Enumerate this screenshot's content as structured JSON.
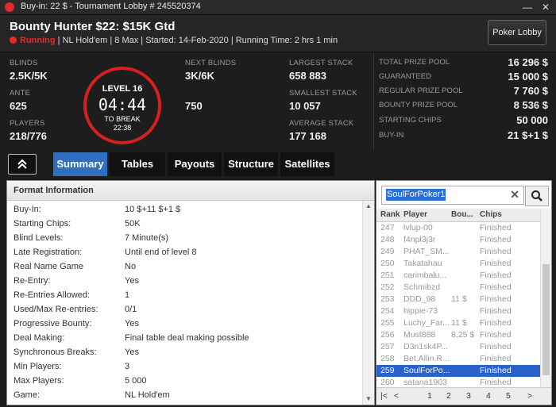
{
  "window": {
    "title": "Buy-in: 22 $ - Tournament Lobby # 245520374",
    "minimize": "—",
    "close": "✕"
  },
  "header": {
    "tournament_name": "Bounty Hunter $22: $15K Gtd",
    "status": "Running",
    "info": "| NL Hold'em | 8 Max | Started: 14-Feb-2020 | Running Time: 2 hrs  1 min",
    "lobby_button": "Poker Lobby"
  },
  "stats": {
    "blinds_label": "BLINDS",
    "blinds": "2.5K/5K",
    "ante_label": "ANTE",
    "ante": "625",
    "players_label": "PLAYERS",
    "players": "218/776",
    "level": "LEVEL 16",
    "timer": "04:44",
    "to_break_label": "TO BREAK",
    "to_break": "22:38",
    "next_blinds_label": "NEXT BLINDS",
    "next_blinds": "3K/6K",
    "next_ante": "750",
    "largest_label": "LARGEST STACK",
    "largest": "658 883",
    "smallest_label": "SMALLEST STACK",
    "smallest": "10 057",
    "average_label": "AVERAGE STACK",
    "average": "177 168"
  },
  "prizes": [
    {
      "label": "TOTAL PRIZE POOL",
      "value": "16 296 $"
    },
    {
      "label": "GUARANTEED",
      "value": "15 000 $"
    },
    {
      "label": "REGULAR PRIZE POOL",
      "value": "7 760 $"
    },
    {
      "label": "BOUNTY PRIZE POOL",
      "value": "8 536 $"
    },
    {
      "label": "STARTING CHIPS",
      "value": "50 000"
    },
    {
      "label": "BUY-IN",
      "value": "21 $+1 $"
    }
  ],
  "tabs": [
    "Summary",
    "Tables",
    "Payouts",
    "Structure",
    "Satellites"
  ],
  "format": {
    "heading": "Format Information",
    "rows": [
      {
        "k": "Buy-In:",
        "v": "10 $+11 $+1 $"
      },
      {
        "k": "Starting Chips:",
        "v": "50K"
      },
      {
        "k": "Blind Levels:",
        "v": "7 Minute(s)"
      },
      {
        "k": "Late Registration:",
        "v": "Until end of level 8"
      },
      {
        "k": "Real Name Game",
        "v": "No"
      },
      {
        "k": "Re-Entry:",
        "v": "Yes"
      },
      {
        "k": "Re-Entries Allowed:",
        "v": "1"
      },
      {
        "k": "Used/Max Re-entries:",
        "v": "0/1"
      },
      {
        "k": "Progressive Bounty:",
        "v": "Yes"
      },
      {
        "k": "Deal Making:",
        "v": "Final table deal making possible"
      },
      {
        "k": "Synchronous Breaks:",
        "v": "Yes"
      },
      {
        "k": "Min Players:",
        "v": "3"
      },
      {
        "k": "Max Players:",
        "v": "5 000"
      },
      {
        "k": "Game:",
        "v": "NL Hold'em"
      }
    ]
  },
  "players_panel": {
    "search_value": "SoulForPoker1",
    "headers": [
      "Rank",
      "Player",
      "Bou...",
      "Chips"
    ],
    "rows": [
      {
        "rank": "247",
        "player": "lvlup-00",
        "bounty": "",
        "chips": "Finished"
      },
      {
        "rank": "248",
        "player": "f4npl3j3r",
        "bounty": "",
        "chips": "Finished"
      },
      {
        "rank": "249",
        "player": "PHAT_SM...",
        "bounty": "",
        "chips": "Finished"
      },
      {
        "rank": "250",
        "player": "Takatahau",
        "bounty": "",
        "chips": "Finished"
      },
      {
        "rank": "251",
        "player": "carimbalu...",
        "bounty": "",
        "chips": "Finished"
      },
      {
        "rank": "252",
        "player": "Schmibzd",
        "bounty": "",
        "chips": "Finished"
      },
      {
        "rank": "253",
        "player": "DDD_98",
        "bounty": "11 $",
        "chips": "Finished"
      },
      {
        "rank": "254",
        "player": "hippie-73",
        "bounty": "",
        "chips": "Finished"
      },
      {
        "rank": "255",
        "player": "Luchy_Far...",
        "bounty": "11 $",
        "chips": "Finished"
      },
      {
        "rank": "256",
        "player": "Must888",
        "bounty": "8,25 $",
        "chips": "Finished"
      },
      {
        "rank": "257",
        "player": "D3n1sk4P...",
        "bounty": "",
        "chips": "Finished"
      },
      {
        "rank": "258",
        "player": "Bet.Allin.R...",
        "bounty": "",
        "chips": "Finished"
      },
      {
        "rank": "259",
        "player": "SoulForPo...",
        "bounty": "",
        "chips": "Finished",
        "selected": true
      },
      {
        "rank": "260",
        "player": "satana1903",
        "bounty": "",
        "chips": "Finished"
      }
    ],
    "pages": [
      "1",
      "2",
      "3",
      "4",
      "5"
    ]
  }
}
